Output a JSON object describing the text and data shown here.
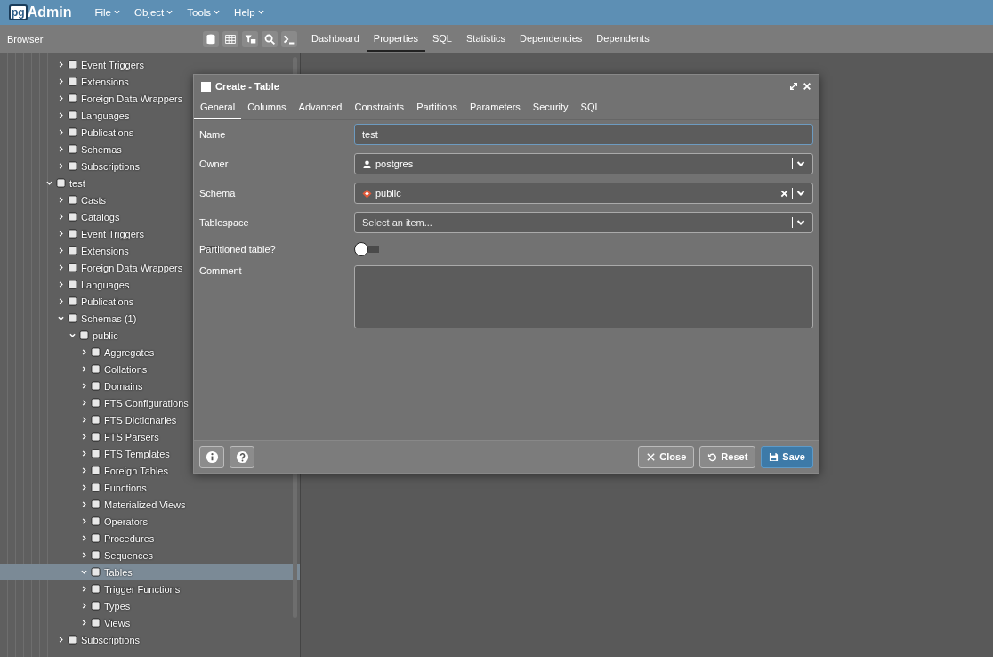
{
  "app": {
    "logo_prefix": "pg",
    "logo_name": "Admin"
  },
  "menu": [
    {
      "label": "File"
    },
    {
      "label": "Object"
    },
    {
      "label": "Tools"
    },
    {
      "label": "Help"
    }
  ],
  "browser_title": "Browser",
  "tabs": [
    {
      "label": "Dashboard",
      "selected": false
    },
    {
      "label": "Properties",
      "selected": true
    },
    {
      "label": "SQL",
      "selected": false
    },
    {
      "label": "Statistics",
      "selected": false
    },
    {
      "label": "Dependencies",
      "selected": false
    },
    {
      "label": "Dependents",
      "selected": false
    }
  ],
  "tree": {
    "continued": [
      {
        "label": "Event Triggers",
        "expanded": false,
        "selected": false
      },
      {
        "label": "Extensions",
        "expanded": false,
        "selected": false
      },
      {
        "label": "Foreign Data Wrappers",
        "expanded": false,
        "selected": false
      },
      {
        "label": "Languages",
        "expanded": false,
        "selected": false
      },
      {
        "label": "Publications",
        "expanded": false,
        "selected": false
      },
      {
        "label": "Schemas",
        "expanded": false,
        "selected": false
      },
      {
        "label": "Subscriptions",
        "expanded": false,
        "selected": false
      }
    ],
    "databases": [
      {
        "label": "test",
        "expanded": true,
        "selected": false,
        "children": [
          {
            "label": "Casts",
            "expanded": false,
            "selected": false
          },
          {
            "label": "Catalogs",
            "expanded": false,
            "selected": false
          },
          {
            "label": "Event Triggers",
            "expanded": false,
            "selected": false
          },
          {
            "label": "Extensions",
            "expanded": false,
            "selected": false
          },
          {
            "label": "Foreign Data Wrappers",
            "expanded": false,
            "selected": false
          },
          {
            "label": "Languages",
            "expanded": false,
            "selected": false
          },
          {
            "label": "Publications",
            "expanded": false,
            "selected": false
          },
          {
            "label": "Schemas (1)",
            "expanded": true,
            "selected": false,
            "children": [
              {
                "label": "public",
                "expanded": true,
                "selected": false,
                "children": [
                  {
                    "label": "Aggregates",
                    "expanded": false,
                    "selected": false
                  },
                  {
                    "label": "Collations",
                    "expanded": false,
                    "selected": false
                  },
                  {
                    "label": "Domains",
                    "expanded": false,
                    "selected": false
                  },
                  {
                    "label": "FTS Configurations",
                    "expanded": false,
                    "selected": false
                  },
                  {
                    "label": "FTS Dictionaries",
                    "expanded": false,
                    "selected": false
                  },
                  {
                    "label": "FTS Parsers",
                    "expanded": false,
                    "selected": false
                  },
                  {
                    "label": "FTS Templates",
                    "expanded": false,
                    "selected": false
                  },
                  {
                    "label": "Foreign Tables",
                    "expanded": false,
                    "selected": false
                  },
                  {
                    "label": "Functions",
                    "expanded": false,
                    "selected": false
                  },
                  {
                    "label": "Materialized Views",
                    "expanded": false,
                    "selected": false
                  },
                  {
                    "label": "Operators",
                    "expanded": false,
                    "selected": false
                  },
                  {
                    "label": "Procedures",
                    "expanded": false,
                    "selected": false
                  },
                  {
                    "label": "Sequences",
                    "expanded": false,
                    "selected": false
                  },
                  {
                    "label": "Tables",
                    "expanded": true,
                    "selected": true
                  },
                  {
                    "label": "Trigger Functions",
                    "expanded": false,
                    "selected": false
                  },
                  {
                    "label": "Types",
                    "expanded": false,
                    "selected": false
                  },
                  {
                    "label": "Views",
                    "expanded": false,
                    "selected": false
                  }
                ]
              }
            ]
          },
          {
            "label": "Subscriptions",
            "expanded": false,
            "selected": false
          }
        ]
      }
    ]
  },
  "dialog": {
    "title": "Create - Table",
    "tabs": [
      {
        "label": "General",
        "selected": true
      },
      {
        "label": "Columns",
        "selected": false
      },
      {
        "label": "Advanced",
        "selected": false
      },
      {
        "label": "Constraints",
        "selected": false
      },
      {
        "label": "Partitions",
        "selected": false
      },
      {
        "label": "Parameters",
        "selected": false
      },
      {
        "label": "Security",
        "selected": false
      },
      {
        "label": "SQL",
        "selected": false
      }
    ],
    "fields": [
      {
        "kind": "text",
        "label": "Name",
        "value": "test"
      },
      {
        "kind": "select",
        "label": "Owner",
        "value": "postgres",
        "clearable": false
      },
      {
        "kind": "select",
        "label": "Schema",
        "value": "public",
        "clearable": true
      },
      {
        "kind": "select",
        "label": "Tablespace",
        "placeholder": "Select an item...",
        "clearable": false
      },
      {
        "kind": "switch",
        "label": "Partitioned table?",
        "on": false
      },
      {
        "kind": "textarea",
        "label": "Comment"
      }
    ],
    "buttons": [
      {
        "kind": "close",
        "label": "Close"
      },
      {
        "kind": "reset",
        "label": "Reset"
      },
      {
        "kind": "save",
        "label": "Save"
      }
    ]
  }
}
